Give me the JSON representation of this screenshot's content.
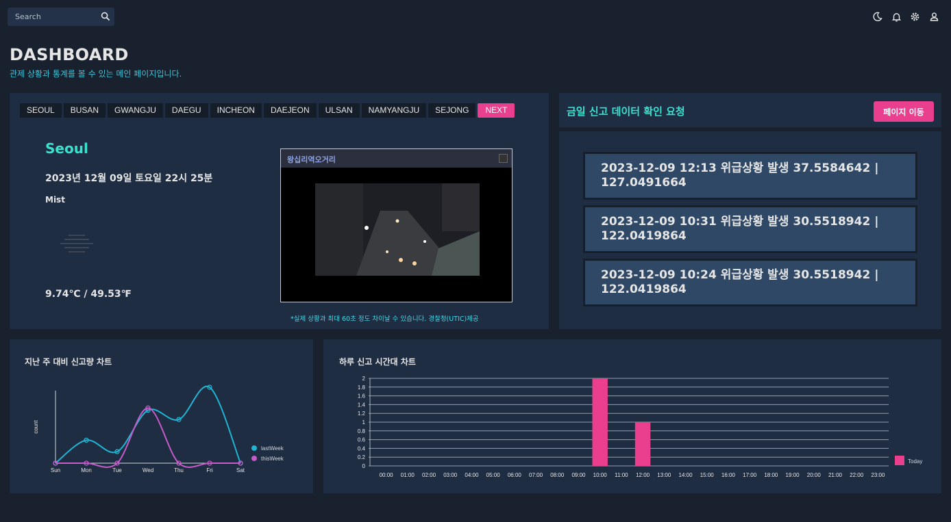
{
  "search": {
    "placeholder": "Search"
  },
  "topbar_icons": [
    "moon-icon",
    "bell-icon",
    "gear-icon",
    "user-icon"
  ],
  "page": {
    "title": "DASHBOARD",
    "subtitle": "관제 상황과 통계를 볼 수 있는 메인 페이지입니다."
  },
  "cities": [
    "SEOUL",
    "BUSAN",
    "GWANGJU",
    "DAEGU",
    "INCHEON",
    "DAEJEON",
    "ULSAN",
    "NAMYANGJU",
    "SEJONG"
  ],
  "next_label": "NEXT",
  "weather": {
    "city": "Seoul",
    "datetime": "2023년 12월 09일 토요일 22시 25분",
    "condition": "Mist",
    "icon": "mist-icon",
    "temperature": "9.74℃ / 49.53℉"
  },
  "cctv": {
    "title": "왕십리역오거리",
    "note": "*실제 상황과 최대 60초 정도 차이날 수 있습니다. 경찰청(UTIC)제공"
  },
  "requests": {
    "title": "금일 신고 데이터 확인 요청",
    "button": "페이지 이동",
    "items": [
      {
        "line1": "2023-12-09 12:13 위급상황 발생 37.5584642 |",
        "line2": "127.0491664"
      },
      {
        "line1": "2023-12-09 10:31 위급상황 발생 30.5518942 |",
        "line2": "122.0419864"
      },
      {
        "line1": "2023-12-09 10:24 위급상황 발생 30.5518942 |",
        "line2": "122.0419864"
      }
    ]
  },
  "colors": {
    "accent": "#ea3f8f",
    "teal": "#36e3cf",
    "lastWeek": "#1fb6d4",
    "thisWeek": "#c55bc9"
  },
  "chart_data": [
    {
      "type": "line",
      "title": "지난 주 대비 신고량 차트",
      "ylabel": "count",
      "categories": [
        "Sun",
        "Mon",
        "Tue",
        "Wed",
        "Thu",
        "Fri",
        "Sat"
      ],
      "series": [
        {
          "name": "lastWeek",
          "values": [
            0,
            1,
            0.5,
            2.3,
            1.9,
            3.3,
            0
          ]
        },
        {
          "name": "thisWeek",
          "values": [
            0,
            0,
            0,
            2.4,
            0,
            0,
            0
          ]
        }
      ],
      "ylim": [
        0,
        3.6
      ],
      "legend": "right"
    },
    {
      "type": "bar",
      "title": "하루 신고 시간대 차트",
      "categories": [
        "00:00",
        "01:00",
        "02:00",
        "03:00",
        "04:00",
        "05:00",
        "06:00",
        "07:00",
        "08:00",
        "09:00",
        "10:00",
        "11:00",
        "12:00",
        "13:00",
        "14:00",
        "15:00",
        "16:00",
        "17:00",
        "18:00",
        "19:00",
        "20:00",
        "21:00",
        "22:00",
        "23:00"
      ],
      "series": [
        {
          "name": "Today",
          "values": [
            0,
            0,
            0,
            0,
            0,
            0,
            0,
            0,
            0,
            0,
            2,
            0,
            1,
            0,
            0,
            0,
            0,
            0,
            0,
            0,
            0,
            0,
            0,
            0
          ]
        }
      ],
      "yticks": [
        "0",
        "0.2",
        "0.4",
        "0.6",
        "0.8",
        "1",
        "1.2",
        "1.4",
        "1.6",
        "1.8",
        "2"
      ],
      "ylim": [
        0,
        2
      ],
      "grid": true,
      "legend": "right"
    }
  ]
}
